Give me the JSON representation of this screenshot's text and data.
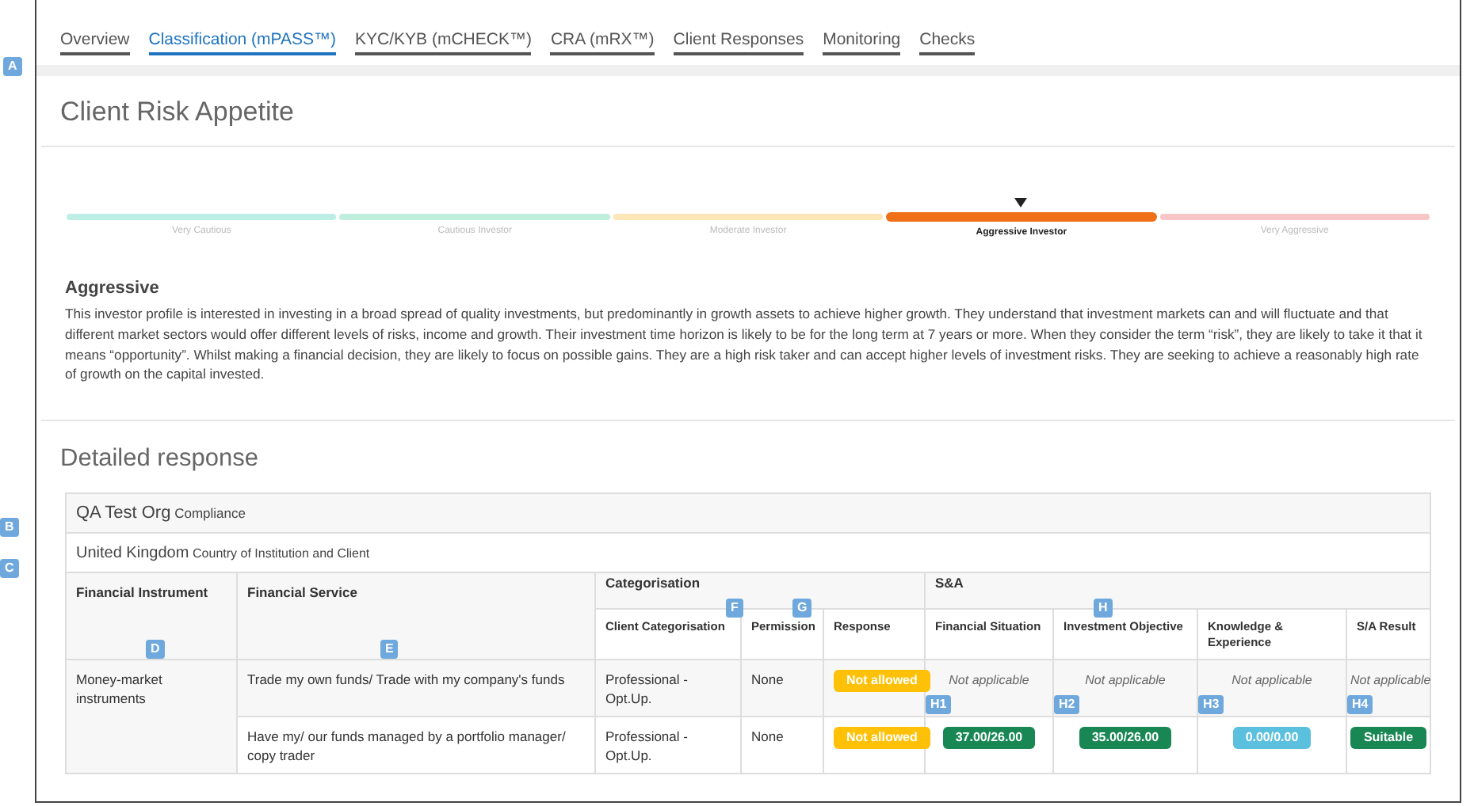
{
  "tabs": [
    {
      "label": "Overview",
      "selected": false
    },
    {
      "label": "Classification (mPASS™)",
      "selected": true
    },
    {
      "label": "KYC/KYB (mCHECK™)",
      "selected": false
    },
    {
      "label": "CRA (mRX™)",
      "selected": false
    },
    {
      "label": "Client Responses",
      "selected": false
    },
    {
      "label": "Monitoring",
      "selected": false
    },
    {
      "label": "Checks",
      "selected": false
    }
  ],
  "risk_appetite": {
    "title": "Client Risk Appetite",
    "levels": [
      {
        "label": "Very Cautious",
        "color": "#bdeee6",
        "selected": false
      },
      {
        "label": "Cautious Investor",
        "color": "#bfeedd",
        "selected": false
      },
      {
        "label": "Moderate Investor",
        "color": "#fde6b8",
        "selected": false
      },
      {
        "label": "Aggressive Investor",
        "color": "#f07018",
        "selected": true
      },
      {
        "label": "Very Aggressive",
        "color": "#f8c6c6",
        "selected": false
      }
    ],
    "profile_title": "Aggressive",
    "profile_text": "This investor profile is interested in investing in a broad spread of quality investments, but predominantly in growth assets to achieve higher growth. They understand that investment markets can and will fluctuate and that different market sectors would offer different levels of risks, income and growth. Their investment time horizon is likely to be for the long term at 7 years or more. When they consider the term “risk”, they are likely to take it that it means “opportunity”. Whilst making a financial decision, they are likely to focus on possible gains. They are a high risk taker and can accept higher levels of investment risks. They are seeking to achieve a reasonably high rate of growth on the capital invested."
  },
  "detailed_response": {
    "title": "Detailed response",
    "org": {
      "name": "QA Test Org",
      "role": "Compliance"
    },
    "country": {
      "name": "United Kingdom",
      "label": "Country of Institution and Client"
    },
    "columns": [
      "Financial Instrument",
      "Financial Service"
    ],
    "groups": [
      "Categorisation",
      "S&A"
    ],
    "subcolumns": [
      "Client Categorisation",
      "Permission",
      "Response",
      "Financial Situation",
      "Investment Objective",
      "Knowledge & Experience",
      "S/A Result"
    ],
    "instrument": "Money-market instruments",
    "rows": [
      {
        "service": "Trade my own funds/ Trade with my company's funds",
        "categorisation": "Professional - Opt.Up.",
        "permission": "None",
        "response": {
          "kind": "badge",
          "text": "Not allowed",
          "color": "#ffc107"
        },
        "cells": [
          {
            "kind": "text",
            "text": "Not applicable"
          },
          {
            "kind": "text",
            "text": "Not applicable"
          },
          {
            "kind": "text",
            "text": "Not applicable"
          },
          {
            "kind": "text",
            "text": "Not applicable"
          }
        ]
      },
      {
        "service": "Have my/ our funds managed by a portfolio manager/ copy trader",
        "categorisation": "Professional - Opt.Up.",
        "permission": "None",
        "response": {
          "kind": "badge",
          "text": "Not allowed",
          "color": "#ffc107"
        },
        "cells": [
          {
            "kind": "badge",
            "text": "37.00/26.00",
            "color": "#198754"
          },
          {
            "kind": "badge",
            "text": "35.00/26.00",
            "color": "#198754"
          },
          {
            "kind": "badge",
            "text": "0.00/0.00",
            "color": "#5bc0de"
          },
          {
            "kind": "badge",
            "text": "Suitable",
            "color": "#198754"
          }
        ]
      }
    ]
  },
  "markers": [
    {
      "label": "A"
    },
    {
      "label": "B"
    },
    {
      "label": "C"
    },
    {
      "label": "D"
    },
    {
      "label": "E"
    },
    {
      "label": "F"
    },
    {
      "label": "G"
    },
    {
      "label": "H"
    },
    {
      "label": "H1"
    },
    {
      "label": "H2"
    },
    {
      "label": "H3"
    },
    {
      "label": "H4"
    }
  ]
}
